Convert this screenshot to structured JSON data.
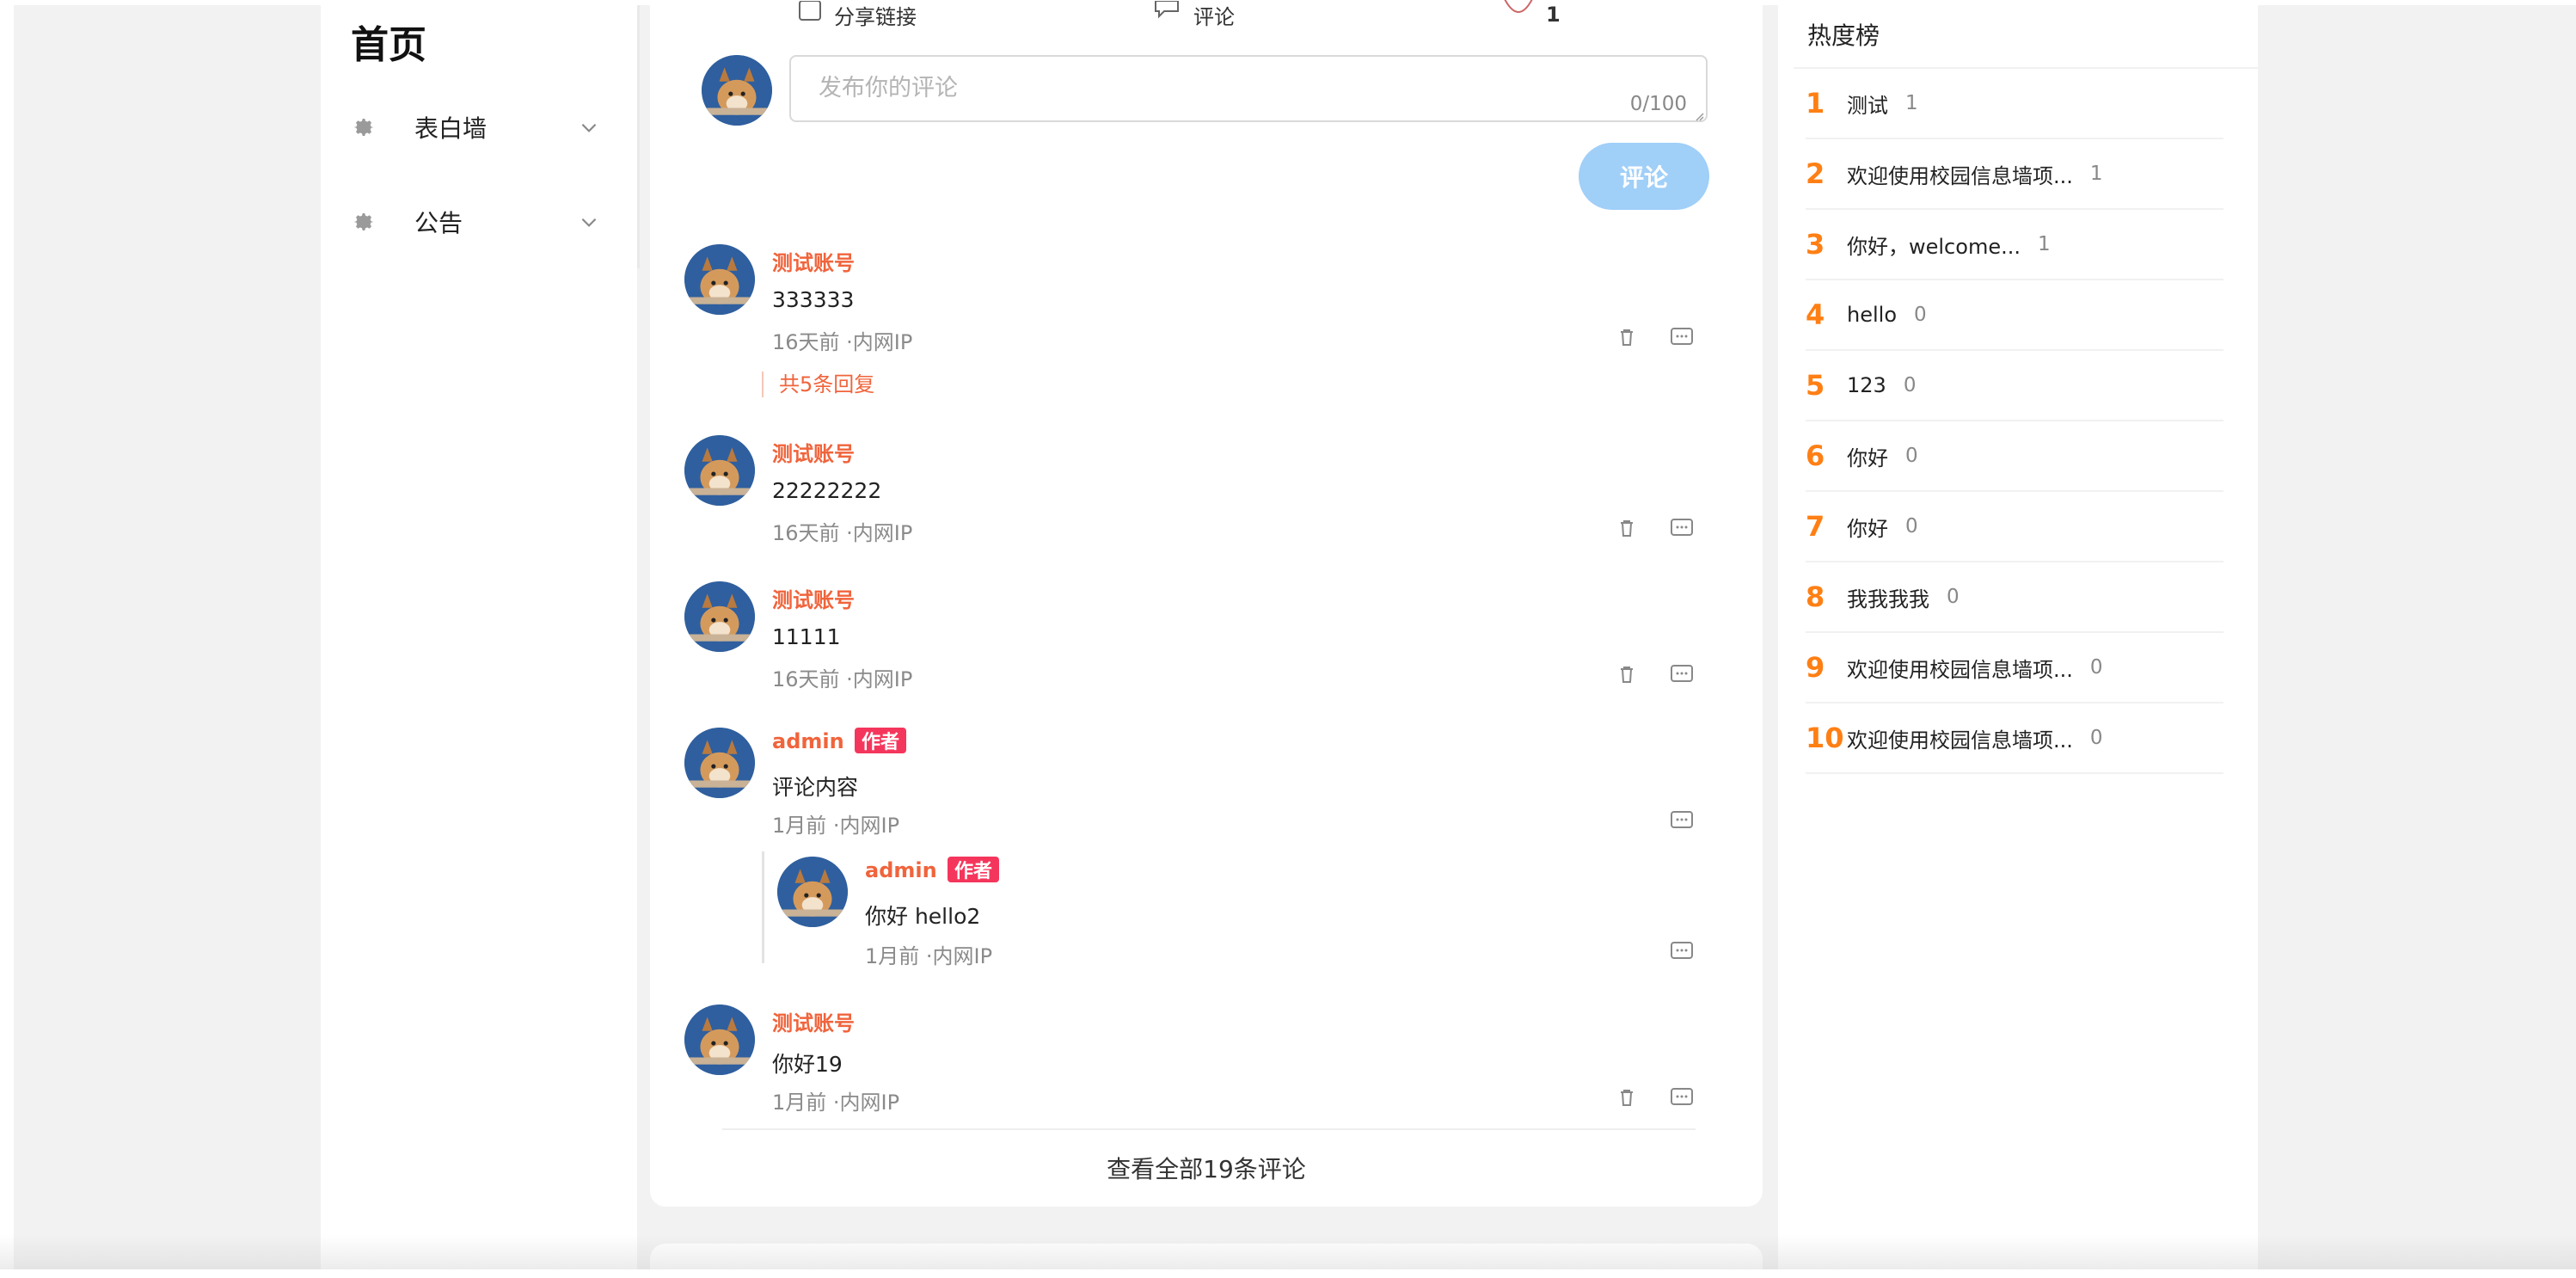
{
  "nav": {
    "home_title": "首页",
    "items": [
      {
        "label": "表白墙"
      },
      {
        "label": "公告"
      }
    ]
  },
  "post_actions": {
    "share_label": "分享链接",
    "comment_label": "评论",
    "like_count": "1"
  },
  "comment_input": {
    "placeholder": "发布你的评论",
    "counter": "0/100",
    "submit_label": "评论"
  },
  "comments": [
    {
      "author": "测试账号",
      "text": "333333",
      "meta": "16天前 ·内网IP",
      "reply_summary": "共5条回复"
    },
    {
      "author": "测试账号",
      "text": "22222222",
      "meta": "16天前 ·内网IP"
    },
    {
      "author": "测试账号",
      "text": "11111",
      "meta": "16天前 ·内网IP"
    },
    {
      "author": "admin",
      "badge": "作者",
      "text": "评论内容",
      "meta": "1月前 ·内网IP",
      "reply": {
        "author": "admin",
        "badge": "作者",
        "text": "你好 hello2",
        "meta": "1月前 ·内网IP"
      }
    },
    {
      "author": "测试账号",
      "text": "你好19",
      "meta": "1月前 ·内网IP"
    }
  ],
  "view_all_label": "查看全部19条评论",
  "hot_list": {
    "title": "热度榜",
    "items": [
      {
        "rank": "1",
        "text": "测试",
        "count": "1"
      },
      {
        "rank": "2",
        "text": "欢迎使用校园信息墙项...",
        "count": "1"
      },
      {
        "rank": "3",
        "text": "你好，welcome...",
        "count": "1"
      },
      {
        "rank": "4",
        "text": "hello",
        "count": "0"
      },
      {
        "rank": "5",
        "text": "123",
        "count": "0"
      },
      {
        "rank": "6",
        "text": "你好",
        "count": "0"
      },
      {
        "rank": "7",
        "text": "你好",
        "count": "0"
      },
      {
        "rank": "8",
        "text": "我我我我",
        "count": "0"
      },
      {
        "rank": "9",
        "text": "欢迎使用校园信息墙项...",
        "count": "0"
      },
      {
        "rank": "10",
        "text": "欢迎使用校园信息墙项...",
        "count": "0"
      }
    ]
  },
  "colors": {
    "accent_orange": "#f0643c",
    "rank_orange": "#ff7f14",
    "badge_red": "#f5365c",
    "submit_blue": "#a0cff8"
  }
}
